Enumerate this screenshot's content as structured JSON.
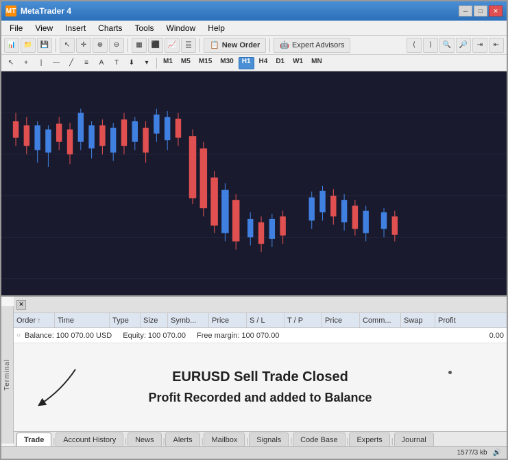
{
  "titlebar": {
    "icon_text": "MT",
    "title": "MetaTrader 4",
    "minimize_label": "─",
    "maximize_label": "□",
    "close_label": "✕"
  },
  "menubar": {
    "items": [
      {
        "label": "File"
      },
      {
        "label": "View"
      },
      {
        "label": "Insert"
      },
      {
        "label": "Charts"
      },
      {
        "label": "Tools"
      },
      {
        "label": "Window"
      },
      {
        "label": "Help"
      }
    ]
  },
  "toolbar": {
    "new_order_label": "New Order",
    "expert_advisors_label": "Expert Advisors"
  },
  "timeframes": {
    "items": [
      "M1",
      "M5",
      "M15",
      "M30",
      "H1",
      "H4",
      "D1",
      "W1",
      "MN"
    ],
    "active": "H1"
  },
  "table": {
    "headers": [
      "Order",
      "Time",
      "Type",
      "Size",
      "Symb...",
      "Price",
      "S / L",
      "T / P",
      "Price",
      "Comm...",
      "Swap",
      "Profit"
    ],
    "balance_row": {
      "label": "Balance: 100 070.00 USD",
      "equity": "Equity: 100 070.00",
      "free_margin": "Free margin: 100 070.00",
      "profit": "0.00"
    }
  },
  "info": {
    "line1": "EURUSD Sell Trade Closed",
    "line2": "Profit Recorded and added to Balance"
  },
  "tabs": {
    "items": [
      "Trade",
      "Account History",
      "News",
      "Alerts",
      "Mailbox",
      "Signals",
      "Code Base",
      "Experts",
      "Journal"
    ],
    "active": "Trade"
  },
  "statusbar": {
    "text": "1577/3 kb"
  },
  "side_label": "Terminal"
}
